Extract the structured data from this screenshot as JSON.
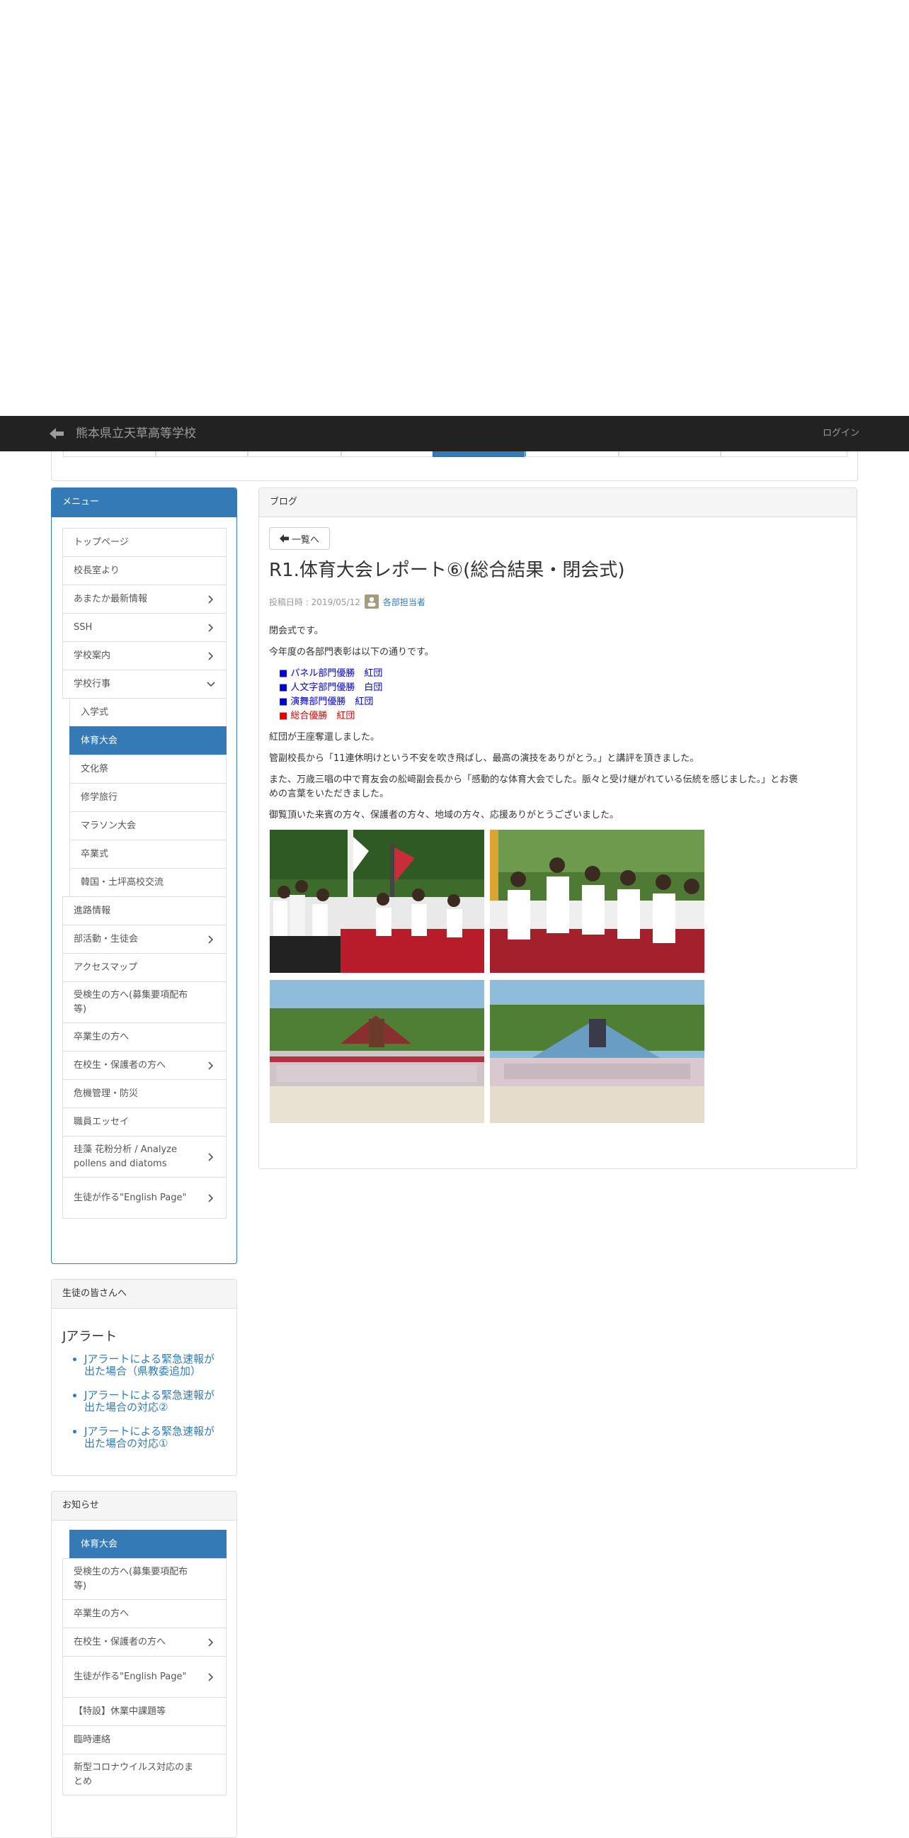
{
  "navbar": {
    "site_title": "熊本県立天草高等学校",
    "login_label": "ログイン"
  },
  "menu_panel": {
    "heading": "メニュー",
    "items": [
      {
        "label": "トップページ",
        "chevron": "none",
        "level": 0
      },
      {
        "label": "校長室より",
        "chevron": "none",
        "level": 0
      },
      {
        "label": "あまたか最新情報",
        "chevron": "right",
        "level": 0
      },
      {
        "label": "SSH",
        "chevron": "right",
        "level": 0
      },
      {
        "label": "学校案内",
        "chevron": "right",
        "level": 0
      },
      {
        "label": "学校行事",
        "chevron": "down",
        "level": 0
      },
      {
        "label": "入学式",
        "chevron": "none",
        "level": 1
      },
      {
        "label": "体育大会",
        "chevron": "none",
        "level": 1,
        "active": true
      },
      {
        "label": "文化祭",
        "chevron": "none",
        "level": 1
      },
      {
        "label": "修学旅行",
        "chevron": "none",
        "level": 1
      },
      {
        "label": "マラソン大会",
        "chevron": "none",
        "level": 1
      },
      {
        "label": "卒業式",
        "chevron": "none",
        "level": 1
      },
      {
        "label": "韓国・土坪高校交流",
        "chevron": "none",
        "level": 1
      },
      {
        "label": "進路情報",
        "chevron": "none",
        "level": 0
      },
      {
        "label": "部活動・生徒会",
        "chevron": "right",
        "level": 0
      },
      {
        "label": "アクセスマップ",
        "chevron": "none",
        "level": 0
      },
      {
        "label": "受検生の方へ(募集要項配布等)",
        "chevron": "none",
        "level": 0
      },
      {
        "label": "卒業生の方へ",
        "chevron": "none",
        "level": 0
      },
      {
        "label": "在校生・保護者の方へ",
        "chevron": "right",
        "level": 0
      },
      {
        "label": "危機管理・防災",
        "chevron": "none",
        "level": 0
      },
      {
        "label": "職員エッセイ",
        "chevron": "none",
        "level": 0
      },
      {
        "label": "珪藻 花粉分析 / Analyze pollens and diatoms",
        "chevron": "right",
        "level": 0
      },
      {
        "label": "生徒が作る\"English Page\"",
        "chevron": "right",
        "level": 0
      }
    ]
  },
  "students_panel": {
    "heading": "生徒の皆さんへ",
    "title": "Jアラート",
    "links": [
      "Jアラートによる緊急速報が出た場合（県教委追加）",
      "Jアラートによる緊急速報が出た場合の対応②",
      "Jアラートによる緊急速報が出た場合の対応①"
    ]
  },
  "news_panel": {
    "heading": "お知らせ",
    "items": [
      {
        "label": "体育大会",
        "chevron": "none",
        "active": true
      },
      {
        "label": "受検生の方へ(募集要項配布等)",
        "chevron": "none"
      },
      {
        "label": "卒業生の方へ",
        "chevron": "none"
      },
      {
        "label": "在校生・保護者の方へ",
        "chevron": "right"
      },
      {
        "label": "生徒が作る\"English Page\"",
        "chevron": "right"
      },
      {
        "label": "【特設】休業中課題等",
        "chevron": "none"
      },
      {
        "label": "臨時連絡",
        "chevron": "none"
      },
      {
        "label": "新型コロナウイルス対応のまとめ",
        "chevron": "none"
      }
    ]
  },
  "blog": {
    "heading": "ブログ",
    "back_label": "一覧へ",
    "title": "R1.体育大会レポート⑥(総合結果・閉会式)",
    "posted": "投稿日時 : 2019/05/12",
    "author": "各部担当者",
    "p1": "閉会式です。",
    "p2": "今年度の各部門表彰は以下の通りです。",
    "awards": [
      {
        "text": "■ パネル部門優勝　紅団",
        "color": "#0000cc"
      },
      {
        "text": "■ 人文字部門優勝　白団",
        "color": "#0000cc"
      },
      {
        "text": "■ 演舞部門優勝　紅団",
        "color": "#0000cc"
      },
      {
        "text": "■ 総合優勝　紅団",
        "color": "#dd0000"
      }
    ],
    "p3": "紅団が王座奪還しました。",
    "p4": "管副校長から「11連休明けという不安を吹き飛ばし、最高の演技をありがとう。」と講評を頂きました。",
    "p5a": "また、万歳三唱の中で育友会の舩﨑副会長から「感動的な体育大会でした。脈々と受け継がれている伝統を感じました。」とお褒",
    "p5b": "めの言葉をいただきました。",
    "p6": "御覧頂いた来賓の方々、保護者の方々、地域の方々、応援ありがとうございました。"
  }
}
